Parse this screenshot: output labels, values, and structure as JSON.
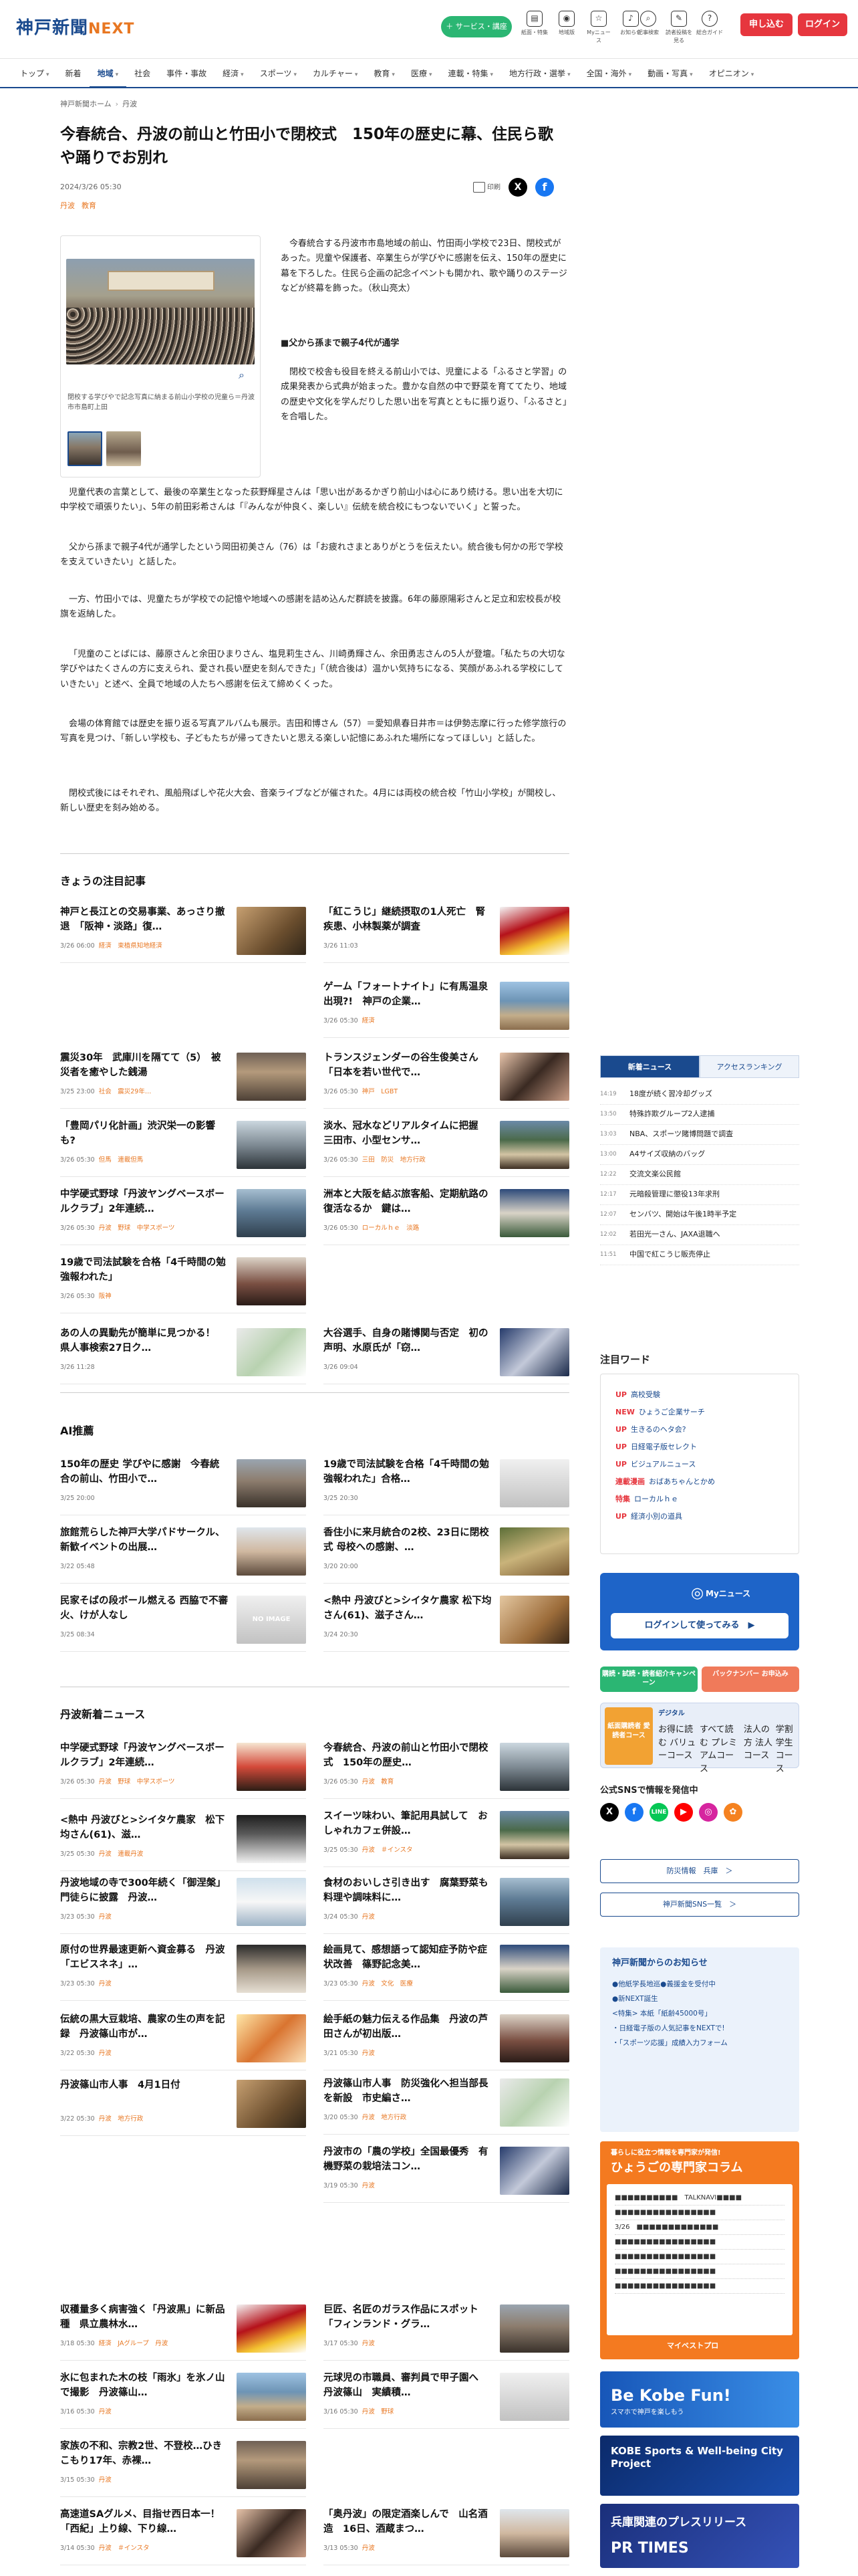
{
  "header": {
    "logo": "神戸新聞",
    "logo_accent": "NEXT",
    "service_btn": "＋ サービス・講座",
    "icons": [
      {
        "label": "紙面・特集",
        "icon": "newspaper-icon"
      },
      {
        "label": "地域版",
        "icon": "map-pin-icon"
      },
      {
        "label": "Myニュース",
        "icon": "star-icon"
      },
      {
        "label": "お知らせ",
        "icon": "bell-icon"
      }
    ],
    "icons2": [
      {
        "label": "記事検索",
        "icon": "search-icon"
      },
      {
        "label": "読者投稿を見る",
        "icon": "pen-icon"
      },
      {
        "label": "総合ガイド",
        "icon": "help-icon"
      }
    ],
    "apply_btn": "申し込む",
    "login_btn": "ログイン"
  },
  "nav": [
    {
      "label": "トップ",
      "caret": true
    },
    {
      "label": "新着",
      "caret": false
    },
    {
      "label": "地域",
      "caret": true,
      "active": true
    },
    {
      "label": "社会",
      "caret": false
    },
    {
      "label": "事件・事故",
      "caret": false
    },
    {
      "label": "経済",
      "caret": true
    },
    {
      "label": "スポーツ",
      "caret": true
    },
    {
      "label": "カルチャー",
      "caret": true
    },
    {
      "label": "教育",
      "caret": true
    },
    {
      "label": "医療",
      "caret": true
    },
    {
      "label": "連載・特集",
      "caret": true
    },
    {
      "label": "地方行政・選挙",
      "caret": true
    },
    {
      "label": "全国・海外",
      "caret": true
    },
    {
      "label": "動画・写真",
      "caret": true
    },
    {
      "label": "オピニオン",
      "caret": true
    }
  ],
  "breadcrumb": [
    "神戸新聞ホーム",
    "丹波"
  ],
  "article": {
    "title": "今春統合、丹波の前山と竹田小で閉校式　150年の歴史に幕、住民ら歌や踊りでお別れ",
    "date": "2024/3/26 05:30",
    "tags": [
      "丹波",
      "教育"
    ],
    "print_label": "印刷",
    "photo_caption": "閉校する学びやで記念写真に納まる前山小学校の児童ら＝丹波市市島町上田",
    "p1": "今春統合する丹波市市島地域の前山、竹田両小学校で23日、閉校式があった。児童や保護者、卒業生らが学びやに感謝を伝え、150年の歴史に幕を下ろした。住民ら企画の記念イベントも開かれ、歌や踊りのステージなどが終幕を飾った。（秋山亮太）",
    "subhead": "■父から孫まで親子4代が通学",
    "p2": "閉校で校舎も役目を終える前山小では、児童による「ふるさと学習」の成果発表から式典が始まった。豊かな自然の中で野菜を育ててたり、地域の歴史や文化を学んだりした思い出を写真とともに振り返り、「ふるさと」を合唱した。",
    "p3": "児童代表の言葉として、最後の卒業生となった荻野輝星さんは「思い出があるかぎり前山小は心にあり続ける。思い出を大切に中学校で頑張りたい」、5年の前田彩希さんは「『みんなが仲良く、楽しい』伝統を統合校にもつないでいく」と誓った。",
    "p4": "父から孫まで親子4代が通学したという岡田初美さん（76）は「お疲れさまとありがとうを伝えたい。統合後も何かの形で学校を支えていきたい」と話した。",
    "p5": "一方、竹田小では、児童たちが学校での記憶や地域への感謝を詰め込んだ群読を披露。6年の藤原陽彩さんと足立和宏校長が校旗を返納した。",
    "p6": "「児童のことばには、藤原さんと余田ひまりさん、塩見莉生さん、川崎勇輝さん、余田勇志さんの5人が登壇。「私たちの大切な学びやはたくさんの方に支えられ、愛され長い歴史を刻んできた」「（統合後は）温かい気持ちになる、笑顔があふれる学校にしていきたい」と述べ、全員で地域の人たちへ感謝を伝えて締めくくった。",
    "p7": "会場の体育館では歴史を振り返る写真アルバムも展示。吉田和博さん（57）＝愛知県春日井市＝は伊勢志摩に行った修学旅行の写真を見つけ、「新しい学校も、子どもたちが帰ってきたいと思える楽しい記憶にあふれた場所になってほしい」と話した。",
    "p8": "閉校式後にはそれぞれ、風船飛ばしや花火大会、音楽ライブなどが催された。4月には両校の統合校「竹山小学校」が開校し、新しい歴史を刻み始める。"
  },
  "sections": {
    "featured_title": "きょうの注目記事",
    "ai_title": "AI推薦",
    "tamba_title": "丹波新着ニュース"
  },
  "featured": [
    {
      "title": "神戸と長江との交易事業、あっさり撤退　「阪神・淡路」復…",
      "time": "3/26 06:00",
      "cats": "経済　束植県知地経済"
    },
    {
      "title": "「紅こうじ」継続摂取の1人死亡　腎疾患、小林製薬が調査",
      "time": "3/26 11:03",
      "cats": ""
    },
    {
      "title": "ゲーム「フォートナイト」に有馬温泉出現?!　神戸の企業…",
      "time": "3/26 05:30",
      "cats": "経済"
    },
    {
      "title": "震災30年　武庫川を隔てて（5）　被災者を癒やした銭湯",
      "time": "3/25 23:00",
      "cats": "社会　震災29年…"
    },
    {
      "title": "トランスジェンダーの谷生俊美さん「日本を若い世代で…",
      "time": "3/26 05:30",
      "cats": "神戸　LGBT"
    },
    {
      "title": "「豊岡パリ化計画」渋沢栄一の影響も?",
      "time": "3/26 05:30",
      "cats": "但馬　連載但馬"
    },
    {
      "title": "淡水、冠水などリアルタイムに把握　三田市、小型センサ…",
      "time": "3/26 05:30",
      "cats": "三田　防災　地方行政"
    },
    {
      "title": "中学硬式野球「丹波ヤングベースボールクラブ」2年連続…",
      "time": "3/26 05:30",
      "cats": "丹波　野球　中学スポーツ"
    },
    {
      "title": "洲本と大阪を結ぶ旅客船、定期航路の復活なるか　鍵は…",
      "time": "3/26 05:30",
      "cats": "ローカルｈｅ　淡路"
    },
    {
      "title": "19歳で司法試験を合格「4千時間の勉強報われた」",
      "time": "3/26 05:30",
      "cats": "阪神"
    },
    {
      "title": "あの人の異動先が簡単に見つかる！　県人事検索27日ク…",
      "time": "3/26 11:28",
      "cats": ""
    },
    {
      "title": "大谷選手、自身の賭博関与否定　初の声明、水原氏が「窃…",
      "time": "3/26 09:04",
      "cats": ""
    }
  ],
  "ai": [
    {
      "title": "150年の歴史 学びやに感謝　今春統合の前山、竹田小で…",
      "time": "3/25 20:00",
      "cats": ""
    },
    {
      "title": "19歳で司法試験を合格「4千時間の勉強報われた」合格…",
      "time": "3/25 20:30",
      "cats": ""
    },
    {
      "title": "旅館荒らした神戸大学パドサークル、新歓イベントの出展…",
      "time": "3/22 05:48",
      "cats": ""
    },
    {
      "title": "香住小に来月統合の2校、23日に閉校式 母校への感謝、…",
      "time": "3/20 20:00",
      "cats": ""
    },
    {
      "title": "民家そばの段ボール燃える 西脇で不審火、けが人なし",
      "time": "3/25 08:34",
      "cats": "",
      "noimg": "NO IMAGE"
    },
    {
      "title": "<熱中 丹波びと>シイタケ農家 松下均さん(61)、滋子さん…",
      "time": "3/24 20:30",
      "cats": ""
    }
  ],
  "tamba_left": [
    {
      "title": "中学硬式野球「丹波ヤングベースボールクラブ」2年連続…",
      "time": "3/26 05:30",
      "cats": "丹波　野球　中学スポーツ"
    },
    {
      "title": "<熱中 丹波びと>シイタケ農家　松下均さん(61)、滋…",
      "time": "3/25 05:30",
      "cats": "丹波　連載丹波"
    },
    {
      "title": "丹波地域の寺で300年続く「御涅槃」門徒らに披露　丹波…",
      "time": "3/23 05:30",
      "cats": "丹波"
    },
    {
      "title": "原付の世界最速更新へ資金募る　丹波「エビスネネ」…",
      "time": "3/23 05:30",
      "cats": "丹波"
    },
    {
      "title": "伝統の黒大豆栽培、農家の生の声を記録　丹波篠山市が…",
      "time": "3/22 05:30",
      "cats": "丹波"
    },
    {
      "title": "丹波篠山市人事　4月1日付",
      "time": "3/22 05:30",
      "cats": "丹波　地方行政"
    },
    {
      "title": "収穫量多く病害強く「丹波黒」に新品種　県立農林水…",
      "time": "3/18 05:30",
      "cats": "経済　JAグループ　丹波"
    },
    {
      "title": "氷に包まれた木の枝「雨氷」を氷ノ山で撮影　丹波篠山…",
      "time": "3/16 05:30",
      "cats": "丹波"
    },
    {
      "title": "家族の不和、宗教2世、不登校…ひきこもり17年、赤裸…",
      "time": "3/15 05:30",
      "cats": "丹波"
    },
    {
      "title": "高速道SAグルメ、目指せ西日本一！「西紀」上り線、下り線…",
      "time": "3/14 05:30",
      "cats": "丹波　＃インスタ"
    }
  ],
  "tamba_right": [
    {
      "title": "今春統合、丹波の前山と竹田小で閉校式　150年の歴史…",
      "time": "3/26 05:30",
      "cats": "丹波　教育"
    },
    {
      "title": "スイーツ味わい、筆記用具試して　おしゃれカフェ併設…",
      "time": "3/25 05:30",
      "cats": "丹波　＃インスタ"
    },
    {
      "title": "食材のおいしさ引き出す　腐葉野菜も料理や調味料に…",
      "time": "3/24 05:30",
      "cats": "丹波"
    },
    {
      "title": "絵画見て、感想語って認知症予防や症状改善　篠野記念美…",
      "time": "3/23 05:30",
      "cats": "丹波　文化　医療"
    },
    {
      "title": "絵手紙の魅力伝える作品集　丹波の芦田さんが初出版…",
      "time": "3/21 05:30",
      "cats": "丹波"
    },
    {
      "title": "丹波篠山市人事　防災強化へ担当部長を新設　市史編さ…",
      "time": "3/20 05:30",
      "cats": "丹波　地方行政"
    },
    {
      "title": "丹波市の「農の学校」全国最優秀　有機野菜の栽培法コン…",
      "time": "3/19 05:30",
      "cats": "丹波"
    },
    {
      "title": "巨匠、名匠のガラス作品にスポット「フィンランド・グラ…",
      "time": "3/17 05:30",
      "cats": "丹波"
    },
    {
      "title": "元球児の市職員、審判員で甲子園へ　丹波篠山　実績積…",
      "time": "3/16 05:30",
      "cats": "丹波　野球"
    },
    {
      "title": "「奥丹波」の限定酒楽しんで　山名酒造　16日、酒蔵まつ…",
      "time": "3/13 05:30",
      "cats": "丹波"
    }
  ],
  "sidebar": {
    "tab_new": "新着ニュース",
    "tab_rank": "アクセスランキング",
    "news": [
      {
        "t": "14:19",
        "x": "18度が続く習冷却グッズ"
      },
      {
        "t": "13:50",
        "x": "特殊詐欺グループ2人逮捕"
      },
      {
        "t": "13:03",
        "x": "NBA、スポーツ賭博問題で調査"
      },
      {
        "t": "13:00",
        "x": "A4サイズ収納のバッグ"
      },
      {
        "t": "12:22",
        "x": "交流文楽公民館"
      },
      {
        "t": "12:17",
        "x": "元暗殺管理に懲役13年求刑"
      },
      {
        "t": "12:07",
        "x": "センバツ、開始は午後1時半予定"
      },
      {
        "t": "12:02",
        "x": "若田光一さん、JAXA退職へ"
      },
      {
        "t": "11:51",
        "x": "中国で紅こうじ販売停止"
      }
    ],
    "kw_title": "注目ワード",
    "keywords": [
      {
        "tag": "UP",
        "text": "高校受験"
      },
      {
        "tag": "NEW",
        "text": "ひょうご企業サーチ"
      },
      {
        "tag": "UP",
        "text": "生きるのヘタ会?"
      },
      {
        "tag": "UP",
        "text": "日経電子版セレクト"
      },
      {
        "tag": "UP",
        "text": "ビジュアルニュース"
      },
      {
        "tag": "連載漫画",
        "text": "おばあちゃんとかめ"
      },
      {
        "tag": "特集",
        "text": "ローカルｈｅ"
      },
      {
        "tag": "UP",
        "text": "経済小別の道具"
      }
    ],
    "myn_label": "Myニュース",
    "myn_btn": "ログインして使ってみる　▶",
    "campaign1": "購読・試読・読者紹介キャンペーン",
    "campaign2": "バックナンバー お申込み",
    "digi_a": "紙面購読者 愛読者コース",
    "digi_b": "デジタル",
    "digi_cells": [
      "お得に読む バリューコース",
      "すべて読む プレミアムコース",
      "法人の方 法人コース",
      "学割 学生コース"
    ],
    "sns_title": "公式SNSで情報を発信中",
    "link1": "防災情報　兵庫　＞",
    "link2": "神戸新聞SNS一覧　＞",
    "notice_title": "神戸新聞からのお知らせ",
    "notices": [
      "●他紙学長地巡●義援金を受付中",
      "●新NEXT誕生",
      "<特集> 本紙「紙齢45000号」",
      "・日経電子版の人気記事をNEXTで!",
      "・「スポーツ応援」成績入力フォーム"
    ],
    "kol_1": "暮らしに役立つ情報を専門家が発信!",
    "kol_2": "ひょうごの専門家コラム",
    "kol_lines": [
      "■■■■■■■■■■　TALKNAVI■■■■",
      "■■■■■■■■■■■■■■■■",
      "3/26　■■■■■■■■■■■■■",
      "■■■■■■■■■■■■■■■■",
      "■■■■■■■■■■■■■■■■",
      "■■■■■■■■■■■■■■■■",
      "■■■■■■■■■■■■■■■■"
    ],
    "kol_3": "マイベストプロ",
    "ad1": "Be Kobe Fun!",
    "ad1_sub": "スマホで神戸を楽しもう",
    "ad2": "KOBE Sports & Well-being City Project",
    "ad3": "兵庫関連のプレスリリース",
    "ad3_sub": "PR TIMES"
  }
}
